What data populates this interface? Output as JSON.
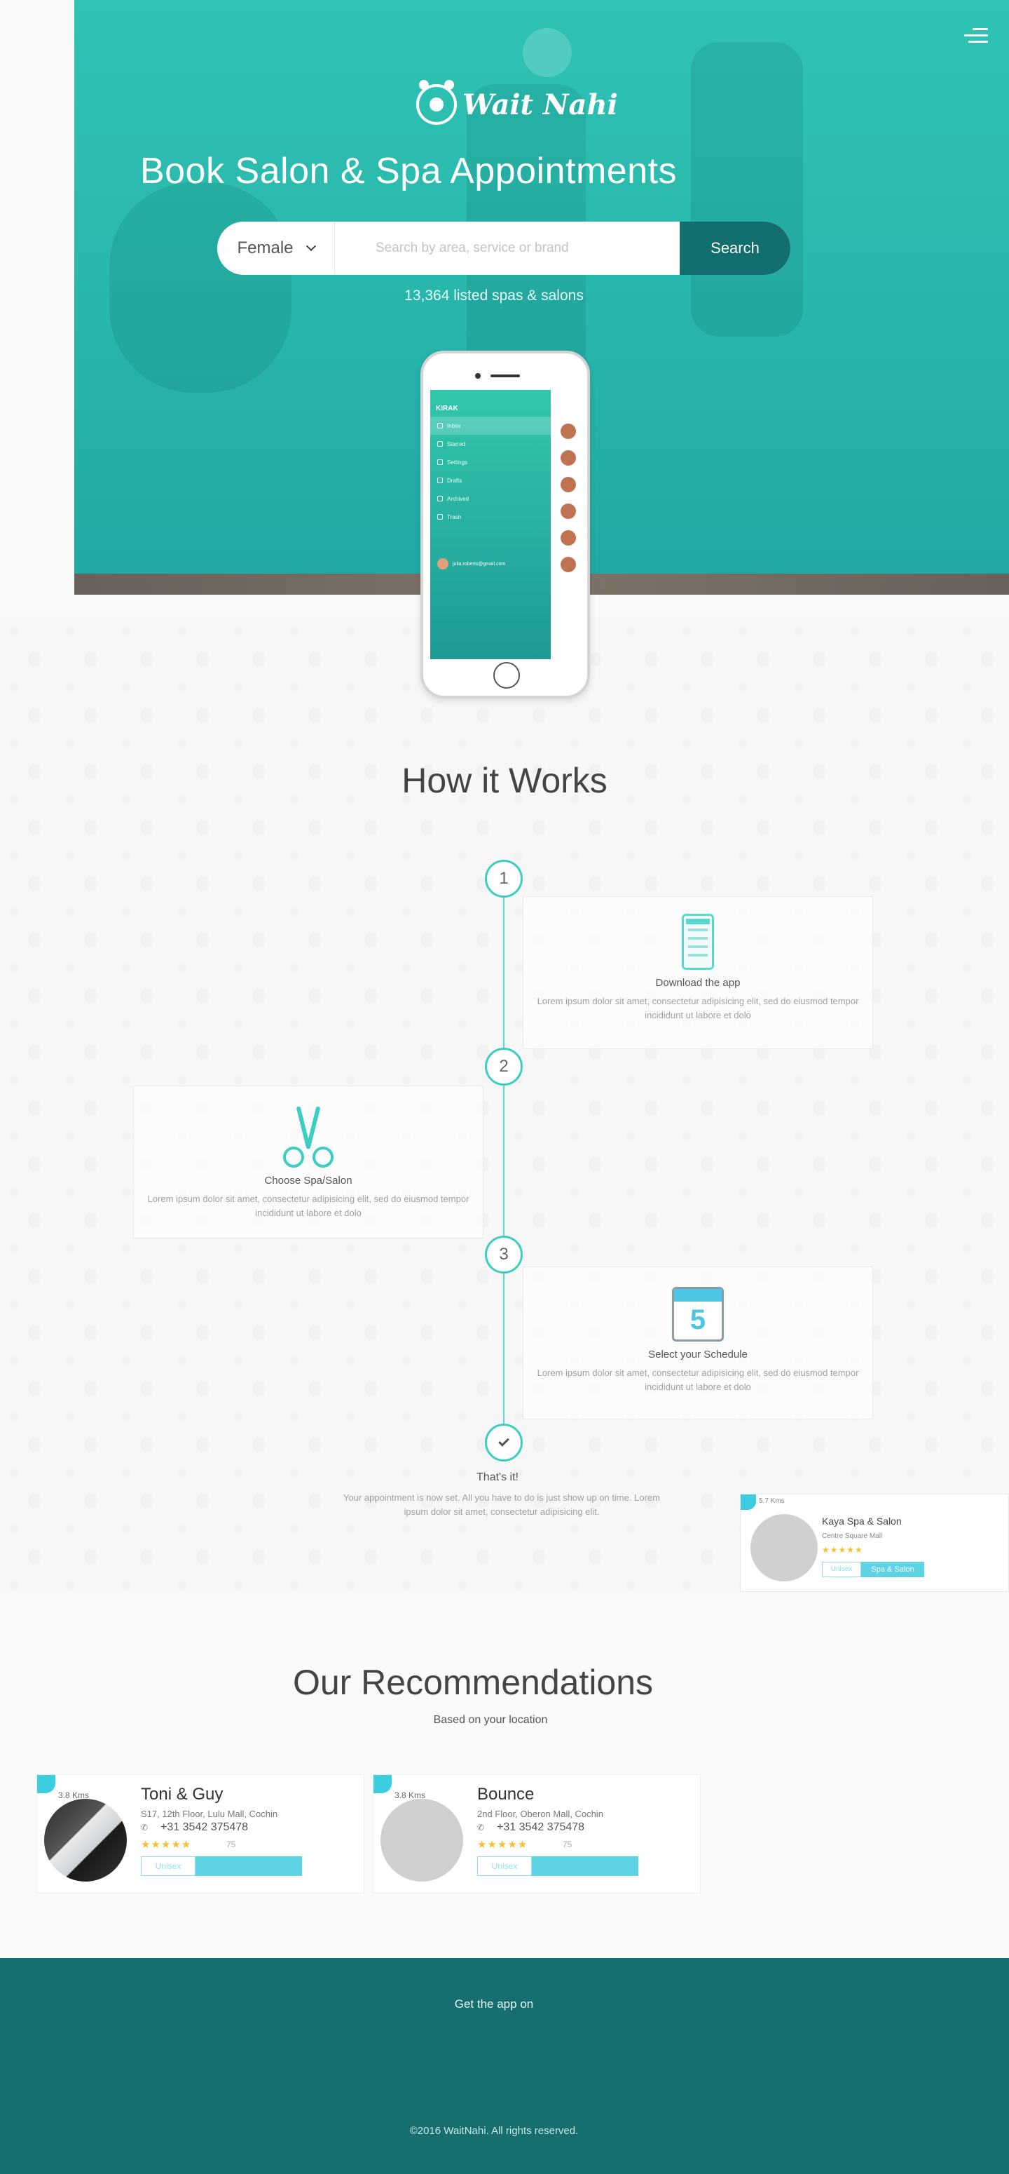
{
  "hero": {
    "logo_text": "Wait Nahi",
    "title": "Book Salon & Spa Appointments",
    "gender": "Female",
    "search_placeholder": "Search by area, service or brand",
    "search_button": "Search",
    "listed": "13,364 listed spas & salons"
  },
  "phone_app": {
    "app_name": "KIRAK",
    "menu": [
      "Inbox",
      "Starred",
      "Settings",
      "Drafts",
      "Archived",
      "Trash"
    ],
    "user": "julia.roberts@gmail.com"
  },
  "how_it_works": {
    "title": "How it Works",
    "steps": [
      {
        "number": "1",
        "title": "Download the app",
        "desc": "Lorem ipsum dolor sit amet, consectetur adipisicing elit, sed do eiusmod tempor incididunt ut labore et dolo"
      },
      {
        "number": "2",
        "title": "Choose Spa/Salon",
        "desc": "Lorem ipsum dolor sit amet, consectetur adipisicing elit, sed do eiusmod tempor incididunt ut labore et dolo"
      },
      {
        "number": "3",
        "title": "Select your Schedule",
        "desc": "Lorem ipsum dolor sit amet, consectetur adipisicing elit, sed do eiusmod tempor incididunt ut labore et dolo"
      }
    ],
    "done_title": "That's it!",
    "done_desc": "Your appointment is now set. All you have to do is just show up on time. Lorem ipsum dolor sit amet, consectetur adipisicing elit.",
    "calendar_day": "5"
  },
  "mini_card": {
    "distance": "5.7 Kms",
    "name": "Kaya Spa & Salon",
    "location": "Centre Square Mall",
    "stars": "★★★★★",
    "btn_outline": "Unisex",
    "btn_fill": "Spa & Salon"
  },
  "recommendations": {
    "title": "Our Recommendations",
    "subtitle": "Based on your location",
    "cards": [
      {
        "distance": "3.8 Kms",
        "name": "Toni & Guy",
        "address": "S17, 12th Floor, Lulu Mall, Cochin",
        "phone": "+31 3542 375478",
        "stars": "★★★★★",
        "reviews": "75",
        "btn_outline": "Unisex"
      },
      {
        "distance": "3.8 Kms",
        "name": "Bounce",
        "address": "2nd Floor, Oberon Mall, Cochin",
        "phone": "+31 3542 375478",
        "stars": "★★★★★",
        "reviews": "75",
        "btn_outline": "Unisex"
      }
    ]
  },
  "footer": {
    "get_app": "Get the app on",
    "copyright": "©2016 WaitNahi. All rights reserved."
  },
  "colors": {
    "teal": "#2fc3b3",
    "dark_teal": "#166e6e",
    "accent": "#5dd3e3",
    "star": "#f4bf35"
  }
}
